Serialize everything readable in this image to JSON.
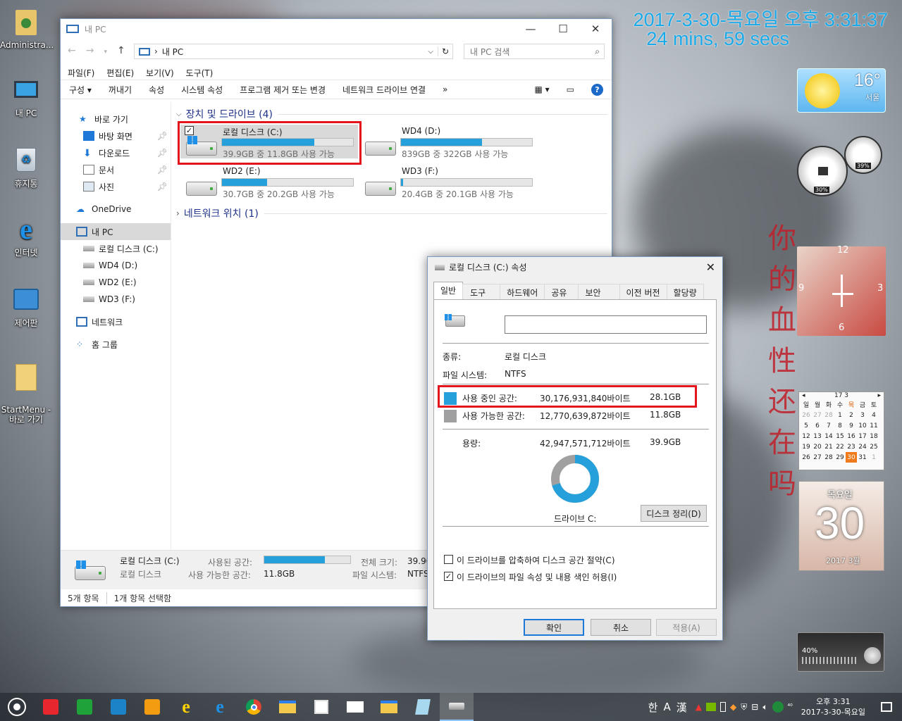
{
  "overlay": {
    "datetime": "2017-3-30-목요일 오후 3:31:37",
    "elapsed": "24 mins, 59 secs"
  },
  "desktop_icons": [
    "Administra...",
    "내 PC",
    "휴지통",
    "인터넷",
    "제어판",
    "StartMenu -\n바로 가기"
  ],
  "explorer": {
    "title": "내 PC",
    "address": "내 PC",
    "address_sep": "›",
    "search_placeholder": "내 PC 검색",
    "menu": [
      "파일(F)",
      "편집(E)",
      "보기(V)",
      "도구(T)"
    ],
    "ribbon": [
      "구성 ▾",
      "꺼내기",
      "속성",
      "시스템 속성",
      "프로그램 제거 또는 변경",
      "네트워크 드라이브 연결",
      "»"
    ],
    "nav": {
      "quick_access": "바로 가기",
      "quick_items": [
        "바탕 화면",
        "다운로드",
        "문서",
        "사진"
      ],
      "onedrive": "OneDrive",
      "this_pc": "내 PC",
      "drives": [
        "로컬 디스크 (C:)",
        "WD4 (D:)",
        "WD2 (E:)",
        "WD3 (F:)"
      ],
      "network": "네트워크",
      "homegroup": "홈 그룹"
    },
    "group_devices": "장치 및 드라이브 (4)",
    "group_network": "네트워크 위치 (1)",
    "drives": [
      {
        "name": "로컬 디스크 (C:)",
        "info": "39.9GB 중 11.8GB 사용 가능",
        "used": 0.704
      },
      {
        "name": "WD4 (D:)",
        "info": "839GB 중 322GB 사용 가능",
        "used": 0.616
      },
      {
        "name": "WD2 (E:)",
        "info": "30.7GB 중 20.2GB 사용 가능",
        "used": 0.342
      },
      {
        "name": "WD3 (F:)",
        "info": "20.4GB 중 20.1GB 사용 가능",
        "used": 0.015
      }
    ],
    "details": {
      "name": "로컬 디스크 (C:)",
      "type": "로컬 디스크",
      "used_label": "사용된 공간:",
      "free_label": "사용 가능한 공간:",
      "free_value": "11.8GB",
      "total_label": "전체 크기:",
      "total_value": "39.9G",
      "fs_label": "파일 시스템:",
      "fs_value": "NTFS",
      "used_fraction": 0.704
    },
    "status": {
      "items": "5개 항목",
      "selected": "1개 항목 선택함"
    }
  },
  "dialog": {
    "title": "로컬 디스크 (C:) 속성",
    "tabs": [
      "일반",
      "도구",
      "하드웨어",
      "공유",
      "보안",
      "이전 버전",
      "할당량"
    ],
    "label_input": "",
    "type_label": "종류:",
    "type_value": "로컬 디스크",
    "fs_label": "파일 시스템:",
    "fs_value": "NTFS",
    "used_label": "사용 중인 공간:",
    "used_bytes": "30,176,931,840바이트",
    "used_gb": "28.1GB",
    "free_label": "사용 가능한 공간:",
    "free_bytes": "12,770,639,872바이트",
    "free_gb": "11.8GB",
    "cap_label": "용량:",
    "cap_bytes": "42,947,571,712바이트",
    "cap_gb": "39.9GB",
    "drive_label": "드라이브 C:",
    "cleanup": "디스크 정리(D)",
    "compress": "이 드라이브를 압축하여 디스크 공간 절약(C)",
    "index": "이 드라이브의 파일 속성 및 내용 색인 허용(I)",
    "ok": "확인",
    "cancel": "취소",
    "apply": "적용(A)",
    "used_fraction": 0.703,
    "colors": {
      "used": "#26a0da",
      "free": "#a0a0a0"
    }
  },
  "gadgets": {
    "weather": {
      "temp": "16°",
      "city": "서울"
    },
    "meter": {
      "cpu": "30%",
      "mem": "39%"
    },
    "clock_numbers": [
      "12",
      "3",
      "6",
      "9"
    ],
    "calendar": {
      "header": "17 3",
      "days": [
        "일",
        "월",
        "화",
        "수",
        "목",
        "금",
        "토"
      ],
      "weeks": [
        [
          "26",
          "27",
          "28",
          "1",
          "2",
          "3",
          "4"
        ],
        [
          "5",
          "6",
          "7",
          "8",
          "9",
          "10",
          "11"
        ],
        [
          "12",
          "13",
          "14",
          "15",
          "16",
          "17",
          "18"
        ],
        [
          "19",
          "20",
          "21",
          "22",
          "23",
          "24",
          "25"
        ],
        [
          "26",
          "27",
          "28",
          "29",
          "30",
          "31",
          "1"
        ]
      ],
      "today": "30"
    },
    "daycard": {
      "weekday": "목요일",
      "day": "30",
      "month": "2017 3월"
    },
    "volume": "40%"
  },
  "taskbar": {
    "ime": [
      "한",
      "A",
      "漢"
    ],
    "time": "오후 3:31",
    "date": "2017-3-30-목요일"
  }
}
